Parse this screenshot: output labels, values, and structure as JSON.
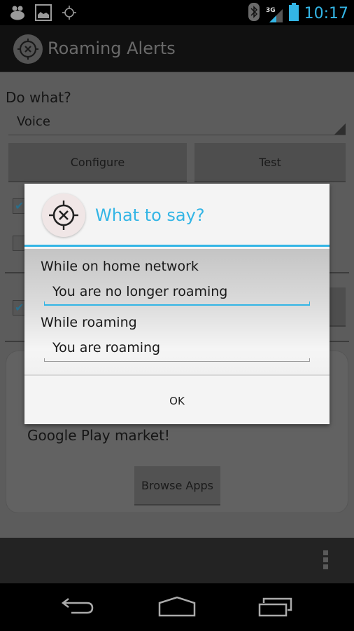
{
  "status_bar": {
    "left_icons": [
      "bbm-icon",
      "picture-icon",
      "gps-icon"
    ],
    "right_icons": [
      "bluetooth-icon",
      "3g-signal-icon",
      "battery-icon"
    ],
    "network_label": "3G",
    "time": "10:17",
    "accent_color": "#33b5e5"
  },
  "action_bar": {
    "title": "Roaming Alerts",
    "icon": "crosshair-x-icon"
  },
  "main": {
    "do_what_label": "Do what?",
    "action_spinner": {
      "selected": "Voice"
    },
    "configure_label": "Configure",
    "test_label": "Test",
    "checkboxes": [
      {
        "checked": true
      },
      {
        "checked": false
      },
      {
        "checked": true
      }
    ],
    "ad": {
      "text_visible": "Google Play market!",
      "browse_label": "Browse Apps"
    }
  },
  "dialog": {
    "title": "What to say?",
    "icon": "crosshair-x-icon",
    "fields": [
      {
        "label": "While on home network",
        "value": "You are no longer roaming",
        "focused": true
      },
      {
        "label": "While roaming",
        "value": "You are roaming",
        "focused": false
      }
    ],
    "ok_label": "OK"
  },
  "bottom_bar": {
    "overflow_icon": "overflow-menu-icon"
  },
  "nav_bar": {
    "buttons": [
      "back",
      "home",
      "recents"
    ]
  }
}
